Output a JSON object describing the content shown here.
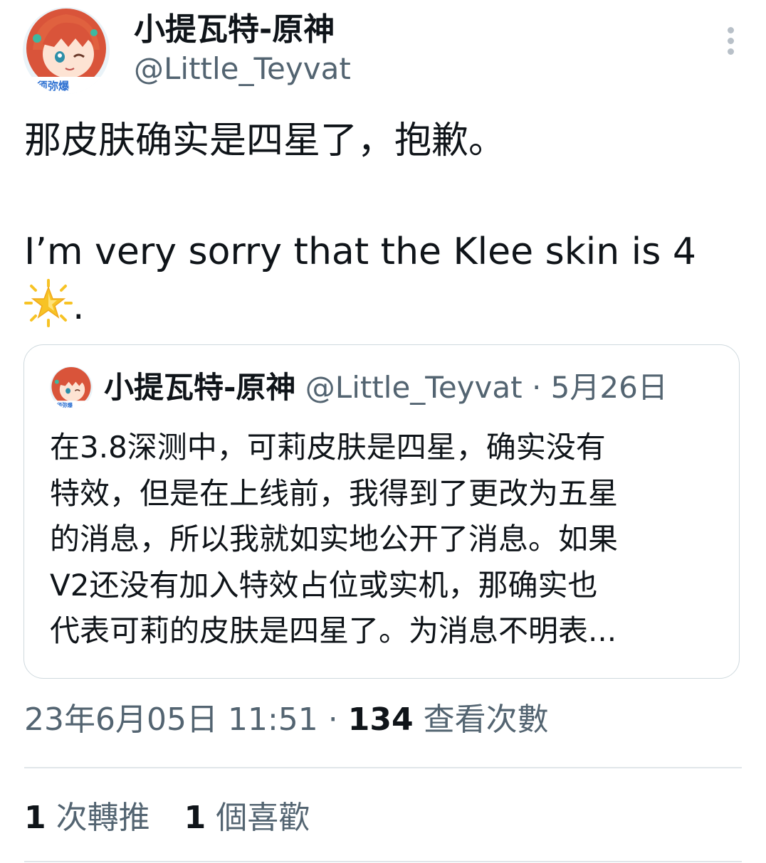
{
  "author": {
    "display_name": "小提瓦特-原神",
    "handle": "@Little_Teyvat",
    "avatar_banner_text": "须弥爆"
  },
  "tweet": {
    "line_zh": "那皮肤确实是四星了，抱歉。",
    "line_en": "I’m very sorry that the Klee skin is 4",
    "line_en_end": ".",
    "emoji": "glowing-star"
  },
  "quoted_tweet": {
    "display_name": "小提瓦特-原神",
    "handle": "@Little_Teyvat",
    "separator": " · ",
    "date": "5月26日",
    "avatar_banner_text": "须弥爆",
    "lines": [
      "在3.8深测中，可莉皮肤是四星，确实没有",
      "特效，但是在上线前，我得到了更改为五星",
      "的消息，所以我就如实地公开了消息。如果",
      "V2还没有加入特效占位或实机，那确实也",
      "代表可莉的皮肤是四星了。为消息不明表..."
    ]
  },
  "meta": {
    "timestamp": "23年6月05日 11:51",
    "separator": " · ",
    "views_count": "134",
    "views_label": "查看次數"
  },
  "stats": {
    "retweets_count": "1",
    "retweets_label": "次轉推",
    "likes_count": "1",
    "likes_label": "個喜歡"
  },
  "colors": {
    "text_primary": "#0f1419",
    "text_secondary": "#536471",
    "border": "#cfd9de",
    "divider": "#e1e6ea",
    "avatar_hair": "#d9543a",
    "avatar_banner": "#2b6fd1",
    "star": "#f7c325"
  },
  "icons": {
    "more": "more-vertical-icon",
    "emoji": "glowing-star-emoji"
  }
}
